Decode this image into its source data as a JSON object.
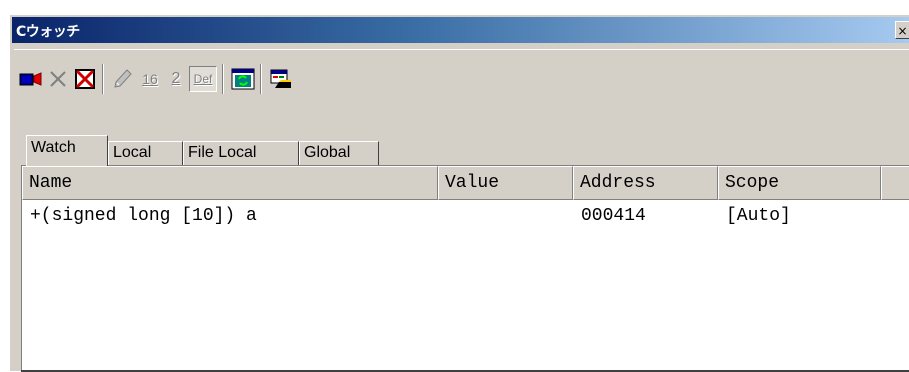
{
  "window": {
    "title": "Cウォッチ",
    "close_glyph": "×"
  },
  "toolbar": {
    "buttons": [
      {
        "icon": "add-watch-icon"
      },
      {
        "icon": "delete-icon"
      },
      {
        "icon": "delete-all-icon"
      },
      {
        "icon": "edit-value-icon"
      },
      {
        "icon": "hex-radix-icon",
        "label": "16"
      },
      {
        "icon": "binary-radix-icon",
        "label": "2"
      },
      {
        "icon": "default-radix-icon",
        "label": "Def"
      },
      {
        "icon": "refresh-icon"
      },
      {
        "icon": "output-icon"
      }
    ]
  },
  "tabs": [
    "Watch",
    "Local",
    "File Local",
    "Global"
  ],
  "table": {
    "columns": [
      "Name",
      "Value",
      "Address",
      "Scope"
    ],
    "rows": [
      {
        "name": "+(signed long [10]) a",
        "value": "",
        "address": "000414",
        "scope": "[Auto]"
      }
    ]
  },
  "colors": {
    "title_start": "#0a246a",
    "title_end": "#a6caf0",
    "face": "#d4d0c8"
  }
}
